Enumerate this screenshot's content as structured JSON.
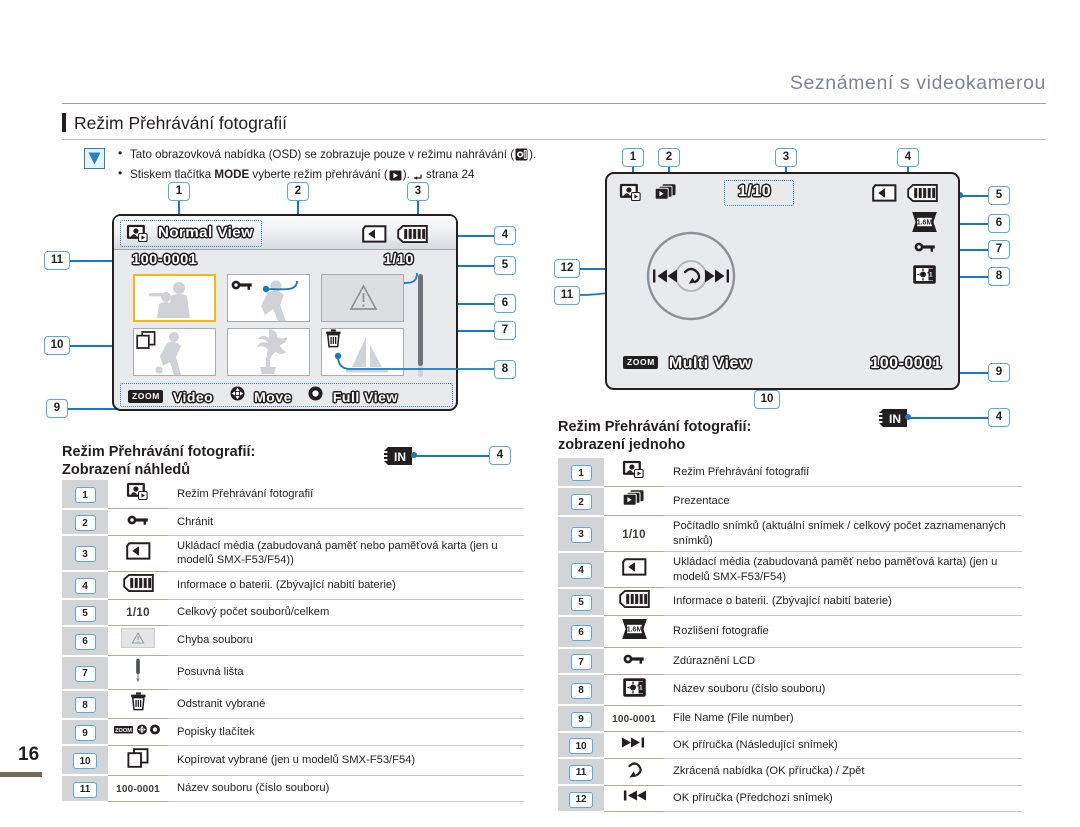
{
  "running_head": "Seznámení s videokamerou",
  "section_title": "Režim Přehrávání fotografií",
  "page_number": "16",
  "note": {
    "icon": "caution-triangle-icon",
    "line1_a": "Tato obrazovková nabídka (OSD) se zobrazuje pouze v režimu nahrávání (",
    "line1_b": ").",
    "line2_a": "Stiskem tlačítka ",
    "line2_bold": "MODE",
    "line2_b": " vyberte režim přehrávání (",
    "line2_c": "). ",
    "line2_ref": "strana 24"
  },
  "lcd_thumbnail": {
    "mode_label": "Normal View",
    "file_name": "100-0001",
    "counter": "1/10",
    "bottom_zoom_chip": "ZOOM",
    "bottom_zoom_label": "Video",
    "bottom_move_label": "Move",
    "bottom_full_label": "Full View",
    "callouts": [
      "1",
      "2",
      "3",
      "4",
      "5",
      "6",
      "7",
      "8",
      "9",
      "10",
      "11"
    ]
  },
  "lcd_single": {
    "counter": "1/10",
    "file_name": "100-0001",
    "bottom_zoom_chip": "ZOOM",
    "bottom_label": "Multi View",
    "resolution_badge": "1.6M",
    "callouts": [
      "1",
      "2",
      "3",
      "4",
      "5",
      "6",
      "7",
      "8",
      "9",
      "10",
      "11",
      "12"
    ]
  },
  "left_table": {
    "title_line1": "Režim Přehrávání fotografií:",
    "title_line2": "Zobrazení náhledů",
    "in_badge": "IN",
    "in_callout": "4",
    "rows": [
      {
        "num": "1",
        "icon": "photo-play-mode-icon",
        "icon_text": "",
        "desc": "Režim Přehrávání fotografií"
      },
      {
        "num": "2",
        "icon": "key-protect-icon",
        "icon_text": "",
        "desc": "Chránit"
      },
      {
        "num": "3",
        "icon": "memory-card-icon",
        "icon_text": "",
        "desc": "Ukládací média (zabudovaná paměť nebo paměťová karta (jen u modelů SMX-F53/F54))"
      },
      {
        "num": "4",
        "icon": "battery-icon",
        "icon_text": "",
        "desc": "Informace o baterii. (Zbývající nabití baterie)"
      },
      {
        "num": "5",
        "icon": "counter-text",
        "icon_text": "1/10",
        "desc": "Celkový počet souborů/celkem"
      },
      {
        "num": "6",
        "icon": "file-error-icon",
        "icon_text": "",
        "desc": "Chyba souboru"
      },
      {
        "num": "7",
        "icon": "scrollbar-icon",
        "icon_text": "",
        "desc": "Posuvná lišta"
      },
      {
        "num": "8",
        "icon": "trash-delete-icon",
        "icon_text": "",
        "desc": "Odstranit vybrané"
      },
      {
        "num": "9",
        "icon": "button-hints-icon",
        "icon_text": "ZOOM",
        "desc": "Popisky tlačítek"
      },
      {
        "num": "10",
        "icon": "copy-pages-icon",
        "icon_text": "",
        "desc": "Kopírovat vybrané (jen u modelů SMX-F53/F54)"
      },
      {
        "num": "11",
        "icon": "file-number-text",
        "icon_text": "100-0001",
        "desc": "Název souboru (číslo souboru)"
      }
    ]
  },
  "right_table": {
    "title_line1": "Režim Přehrávání fotografií:",
    "title_line2": "zobrazení jednoho",
    "in_badge": "IN",
    "in_callout": "4",
    "rows": [
      {
        "num": "1",
        "icon": "photo-play-mode-icon",
        "icon_text": "",
        "desc": "Režim Přehrávání fotografií"
      },
      {
        "num": "2",
        "icon": "slideshow-icon",
        "icon_text": "",
        "desc": "Prezentace"
      },
      {
        "num": "3",
        "icon": "counter-text",
        "icon_text": "1/10",
        "desc": "Počítadlo snímků (aktuální snímek / celkový počet zaznamenaných snímků)"
      },
      {
        "num": "4",
        "icon": "memory-card-icon",
        "icon_text": "",
        "desc": "Ukládací média (zabudovaná paměť nebo paměťová karta) (jen u modelů SMX-F53/F54)"
      },
      {
        "num": "5",
        "icon": "battery-icon",
        "icon_text": "",
        "desc": "Informace o baterii. (Zbývající nabití baterie)"
      },
      {
        "num": "6",
        "icon": "photo-resolution-icon",
        "icon_text": "1.6M",
        "desc": "Rozlišení fotografie"
      },
      {
        "num": "7",
        "icon": "key-protect-icon",
        "icon_text": "",
        "desc": "Zdúraznění LCD"
      },
      {
        "num": "8",
        "icon": "lcd-enhancer-icon",
        "icon_text": "",
        "desc": "Název souboru (číslo souboru)"
      },
      {
        "num": "9",
        "icon": "file-number-text",
        "icon_text": "100-0001",
        "desc": "File Name (File number)"
      },
      {
        "num": "10",
        "icon": "next-image-icon",
        "icon_text": "",
        "desc": "OK příručka (Následující snímek)"
      },
      {
        "num": "11",
        "icon": "back-return-icon",
        "icon_text": "",
        "desc": "Zkrácená nabídka (OK příručka) / Zpět"
      },
      {
        "num": "12",
        "icon": "prev-image-icon",
        "icon_text": "",
        "desc": "OK příručka (Předchozí snímek)"
      }
    ]
  },
  "colors": {
    "callout_border": "#5aa9de",
    "leader_line": "#1a78c2",
    "selection": "#f5b618",
    "runhead": "#7d8690"
  }
}
